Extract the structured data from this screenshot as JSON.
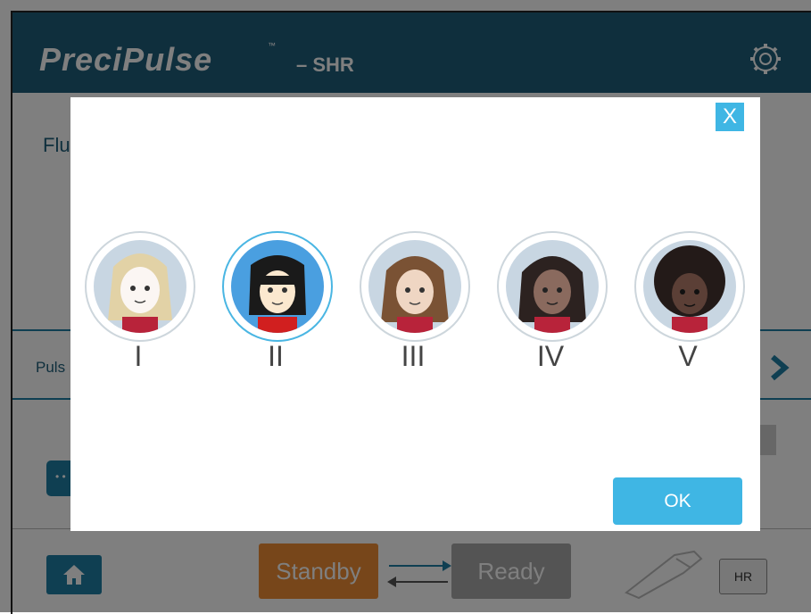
{
  "app": {
    "logo": "PreciPulse",
    "logo_tm": "™",
    "mode": "– SHR"
  },
  "background": {
    "fluence_label": "Flu",
    "pulse_label": "Puls",
    "standby_label": "Standby",
    "ready_label": "Ready",
    "hr_label": "HR"
  },
  "dialog": {
    "close_label": "X",
    "ok_label": "OK",
    "skin_types": [
      {
        "label": "I"
      },
      {
        "label": "II"
      },
      {
        "label": "III"
      },
      {
        "label": "IV"
      },
      {
        "label": "V"
      }
    ],
    "selected_index": 1
  },
  "colors": {
    "header": "#1f5f7a",
    "accent": "#3fb6e4",
    "standby": "#ef8c34",
    "ready": "#a9a9a9"
  }
}
